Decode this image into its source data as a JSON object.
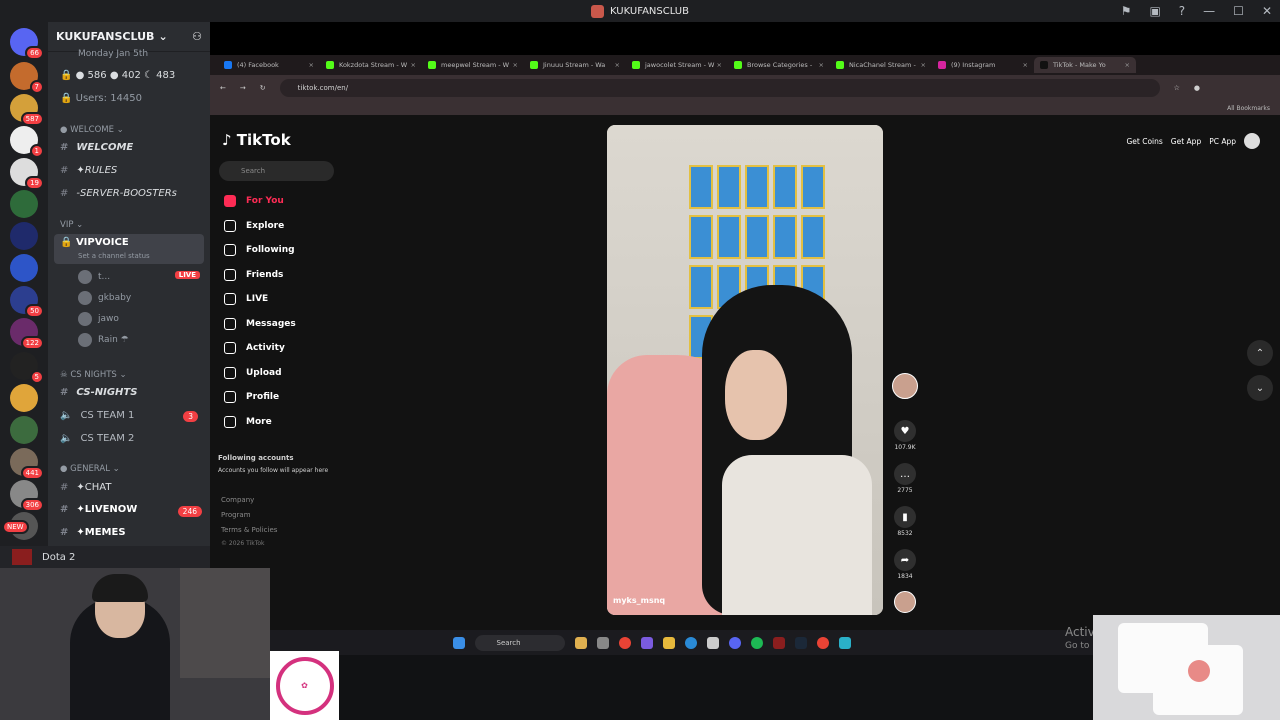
{
  "window": {
    "title": "KUKUFANSCLUB"
  },
  "server_badges": [
    "66",
    "7",
    "587",
    "1",
    "19",
    "50",
    "122",
    "5",
    "441",
    "306",
    "NEW"
  ],
  "channels": {
    "server_name": "KUKUFANSCLUB",
    "date_partial": "Monday Jan 5th",
    "stats": {
      "online": "586",
      "dnd": "402",
      "idle": "483"
    },
    "users": "Users: 14450",
    "cat_welcome": "WELCOME",
    "welcome": "WELCOME",
    "rules": "✦RULES",
    "boosters": "-SERVER-BOOSTERs",
    "cat_vip": "VIP",
    "vipvoice": "VIPVOICE",
    "vip_status": "Set a channel status",
    "voice_users": [
      "t...",
      "gkbaby",
      "jawo",
      "Rain ☂"
    ],
    "live_label": "LIVE",
    "cat_cs": "CS NIGHTS",
    "cs_nights": "CS-NIGHTS",
    "cs_team1": "CS TEAM 1",
    "cs_team1_count": "3",
    "cs_team2": "CS TEAM 2",
    "cat_general": "GENERAL",
    "chat": "✦CHAT",
    "livenow": "✦LIVENOW",
    "livenow_count": "246",
    "memes": "✦MEMES",
    "dota": "Dota 2"
  },
  "browser": {
    "tabs": [
      {
        "label": "(4) Facebook",
        "color": "#1877f2"
      },
      {
        "label": "Kokzdota Stream - W",
        "color": "#53fc18"
      },
      {
        "label": "meepwel Stream - W",
        "color": "#53fc18"
      },
      {
        "label": "Jinuuu Stream - Wa",
        "color": "#53fc18"
      },
      {
        "label": "jawocolet Stream - W",
        "color": "#53fc18"
      },
      {
        "label": "Browse Categories -",
        "color": "#53fc18"
      },
      {
        "label": "NicaChanel Stream -",
        "color": "#53fc18"
      },
      {
        "label": "(9) Instagram",
        "color": "#d6249f"
      },
      {
        "label": "TikTok - Make Yo",
        "color": "#111111"
      }
    ],
    "url": "tiktok.com/en/",
    "bookmarks": "All Bookmarks"
  },
  "tiktok": {
    "logo": "TikTok",
    "search_placeholder": "Search",
    "nav": [
      "For You",
      "Explore",
      "Following",
      "Friends",
      "LIVE",
      "Messages",
      "Activity",
      "Upload",
      "Profile",
      "More"
    ],
    "following_title": "Following accounts",
    "following_sub": "Accounts you follow will appear here",
    "footer": [
      "Company",
      "Program",
      "Terms & Policies",
      "© 2026 TikTok"
    ],
    "top_actions": [
      "Get Coins",
      "Get App",
      "PC App"
    ],
    "video_user": "myks_msnq",
    "likes": "107.9K",
    "comments": "2775",
    "saves": "8532",
    "shares": "1834"
  },
  "taskbar": {
    "search": "Search"
  },
  "overlay": {
    "activate": "Activ",
    "goto": "Go to"
  }
}
